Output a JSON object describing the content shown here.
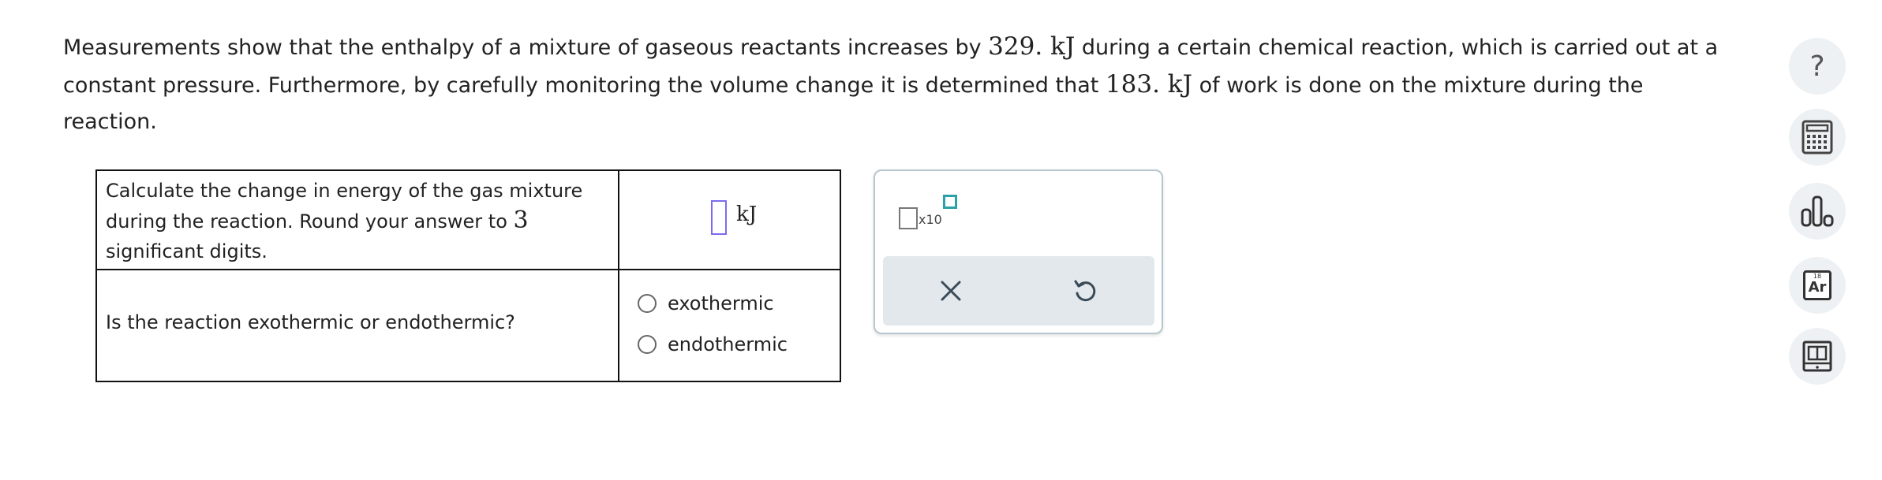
{
  "problem": {
    "part1": "Measurements show that the enthalpy of a mixture of gaseous reactants increases by ",
    "value1": "329. kJ",
    "part2": " during a certain chemical reaction, which is carried out at a constant pressure. Furthermore, by carefully monitoring the volume change it is determined that ",
    "value2": "183. kJ",
    "part3": " of work is done on the mixture during the reaction."
  },
  "table": {
    "q1_part1": "Calculate the change in energy of the gas mixture during the reaction. Round your answer to ",
    "q1_digits": "3",
    "q1_part2": " significant digits.",
    "q1_answer_value": "",
    "q1_unit": "kJ",
    "q2_text": "Is the reaction exothermic or endothermic?",
    "options": [
      "exothermic",
      "endothermic"
    ],
    "selected_option": null
  },
  "toolbox": {
    "sci_notation_label": "x10",
    "clear_label": "clear",
    "undo_label": "undo",
    "accent_color": "#2aa1a6"
  },
  "sidebar": {
    "help_label": "?",
    "tools": [
      "help-icon",
      "calculator-icon",
      "data-chart-icon",
      "periodic-table-icon",
      "reference-book-icon"
    ],
    "periodic_element": {
      "number": "18",
      "symbol": "Ar"
    }
  }
}
